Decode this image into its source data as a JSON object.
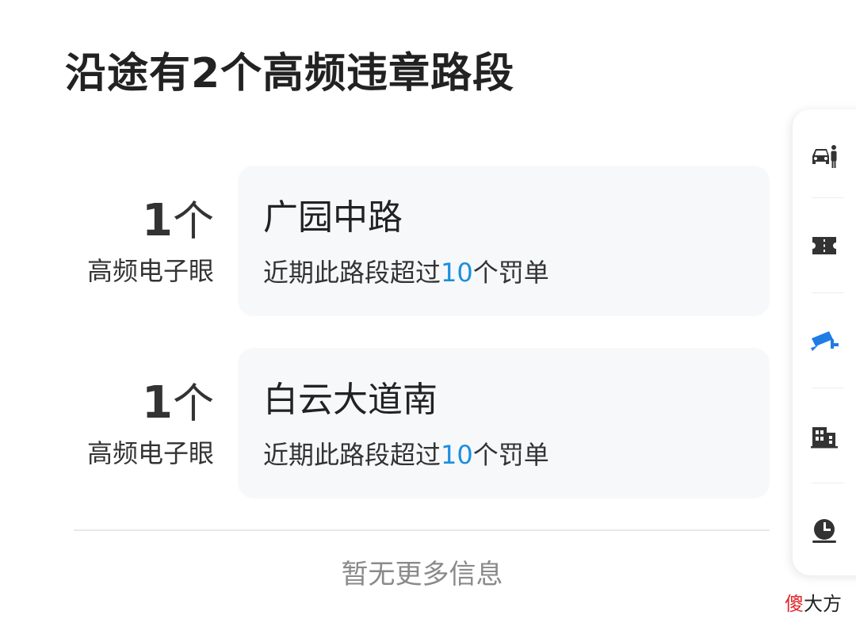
{
  "header": {
    "title": "沿途有2个高频违章路段"
  },
  "segments": [
    {
      "count_num": "1",
      "count_unit": "个",
      "count_label": "高频电子眼",
      "road_name": "广园中路",
      "desc_prefix": "近期此路段超过",
      "desc_number": "10",
      "desc_suffix": "个罚单"
    },
    {
      "count_num": "1",
      "count_unit": "个",
      "count_label": "高频电子眼",
      "road_name": "白云大道南",
      "desc_prefix": "近期此路段超过",
      "desc_number": "10",
      "desc_suffix": "个罚单"
    }
  ],
  "footer": {
    "no_more": "暂无更多信息"
  },
  "side_panel": {
    "items": [
      {
        "icon": "car-person-icon",
        "active": false
      },
      {
        "icon": "ticket-icon",
        "active": false
      },
      {
        "icon": "camera-icon",
        "active": true
      },
      {
        "icon": "building-icon",
        "active": false
      },
      {
        "icon": "clock-icon",
        "active": false
      }
    ]
  },
  "watermark": {
    "red_part": "傻",
    "black_part": "大方"
  },
  "colors": {
    "accent": "#1a8fe0",
    "active_icon": "#1e7ce6",
    "icon": "#333333",
    "card_bg": "#f7f8fa"
  }
}
